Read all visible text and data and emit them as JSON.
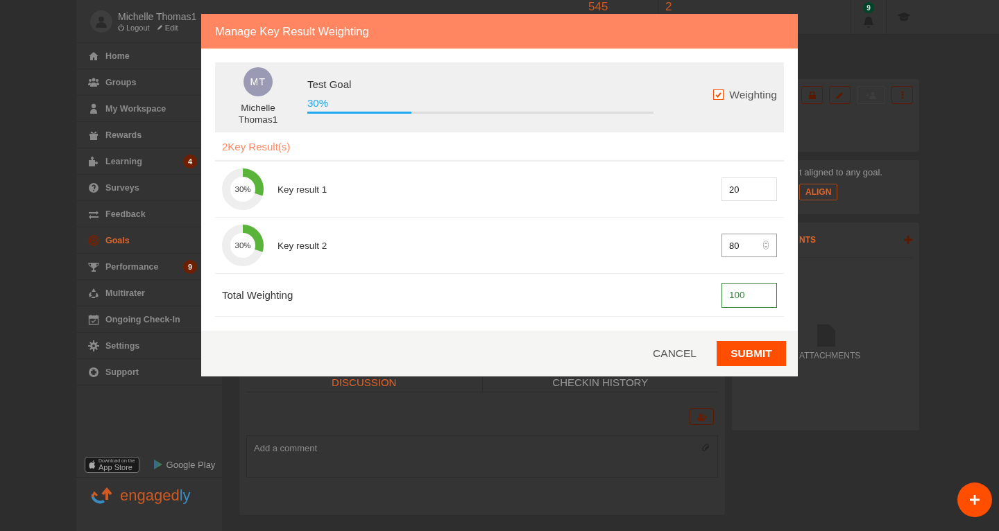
{
  "header": {
    "stats": [
      "545",
      "2"
    ],
    "notification_count": "9"
  },
  "user": {
    "name": "Michelle Thomas1",
    "actions": [
      "Logout",
      "Edit"
    ]
  },
  "sidebar": {
    "items": [
      {
        "label": "Home",
        "selected": false
      },
      {
        "label": "Groups",
        "selected": false
      },
      {
        "label": "My Workspace",
        "selected": false
      },
      {
        "label": "Rewards",
        "selected": false
      },
      {
        "label": "Learning",
        "selected": false,
        "badge": "4"
      },
      {
        "label": "Surveys",
        "selected": false
      },
      {
        "label": "Feedback",
        "selected": false
      },
      {
        "label": "Goals",
        "selected": true
      },
      {
        "label": "Performance",
        "selected": false,
        "badge": "9"
      },
      {
        "label": "Multirater",
        "selected": false
      },
      {
        "label": "Ongoing Check-In",
        "selected": false
      },
      {
        "label": "Settings",
        "selected": false
      },
      {
        "label": "Support",
        "selected": false
      }
    ]
  },
  "stores": {
    "app_store": {
      "small": "Download on the",
      "big": "App Store"
    },
    "google_play": "Google Play"
  },
  "logo": "engagedly",
  "background": {
    "alignment_text": "t aligned to any goal.",
    "align_button": "ALIGN",
    "attachments_title": "NTS",
    "attachments_empty": "ATTACHMENTS",
    "tabs": [
      {
        "label": "DISCUSSION",
        "selected": true
      },
      {
        "label": "CHECKIN HISTORY",
        "selected": false
      }
    ],
    "comment": {
      "placeholder": "Add a comment"
    }
  },
  "modal": {
    "title": "Manage Key Result Weighting",
    "owner": {
      "initials": "MT",
      "name": "Michelle Thomas1"
    },
    "goal": {
      "title": "Test Goal",
      "progress_text": "30%",
      "level": 0.3
    },
    "weighting": {
      "label": "Weighting",
      "checked": true
    },
    "key_results_heading": "2Key Result(s)",
    "key_results": [
      {
        "progress_text": "30%",
        "level": 0.3,
        "name": "Key result 1",
        "weight": "20",
        "focused": false
      },
      {
        "progress_text": "30%",
        "level": 0.3,
        "name": "Key result 2",
        "weight": "80",
        "focused": true
      }
    ],
    "total": {
      "label": "Total Weighting",
      "value": "100"
    },
    "buttons": {
      "cancel": "CANCEL",
      "submit": "SUBMIT"
    }
  }
}
